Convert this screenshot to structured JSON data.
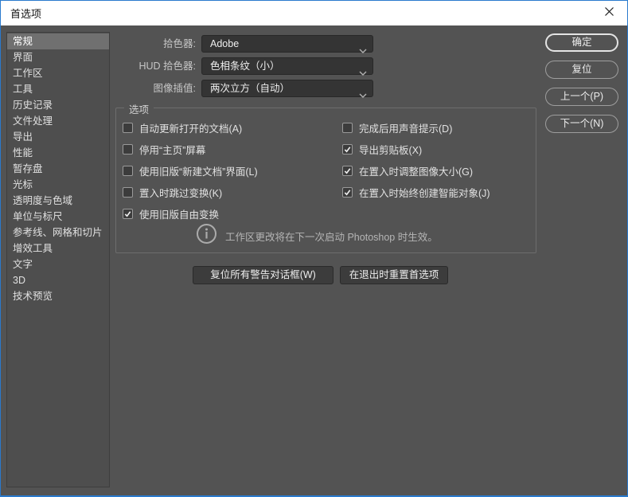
{
  "window": {
    "title": "首选项"
  },
  "sidebar": {
    "items": [
      {
        "label": "常规",
        "selected": true
      },
      {
        "label": "界面",
        "selected": false
      },
      {
        "label": "工作区",
        "selected": false
      },
      {
        "label": "工具",
        "selected": false
      },
      {
        "label": "历史记录",
        "selected": false
      },
      {
        "label": "文件处理",
        "selected": false
      },
      {
        "label": "导出",
        "selected": false
      },
      {
        "label": "性能",
        "selected": false
      },
      {
        "label": "暂存盘",
        "selected": false
      },
      {
        "label": "光标",
        "selected": false
      },
      {
        "label": "透明度与色域",
        "selected": false
      },
      {
        "label": "单位与标尺",
        "selected": false
      },
      {
        "label": "参考线、网格和切片",
        "selected": false
      },
      {
        "label": "增效工具",
        "selected": false
      },
      {
        "label": "文字",
        "selected": false
      },
      {
        "label": "3D",
        "selected": false
      },
      {
        "label": "技术预览",
        "selected": false
      }
    ]
  },
  "pickers": [
    {
      "label": "拾色器:",
      "value": "Adobe"
    },
    {
      "label": "HUD 拾色器:",
      "value": "色相条纹（小）"
    },
    {
      "label": "图像插值:",
      "value": "两次立方（自动）"
    }
  ],
  "options": {
    "legend": "选项",
    "left": [
      {
        "label": "自动更新打开的文档(A)",
        "checked": false
      },
      {
        "label": "停用“主页”屏幕",
        "checked": false
      },
      {
        "label": "使用旧版“新建文档”界面(L)",
        "checked": false
      },
      {
        "label": "置入时跳过变换(K)",
        "checked": false
      },
      {
        "label": "使用旧版自由变换",
        "checked": true
      }
    ],
    "right": [
      {
        "label": "完成后用声音提示(D)",
        "checked": false
      },
      {
        "label": "导出剪贴板(X)",
        "checked": true
      },
      {
        "label": "在置入时调整图像大小(G)",
        "checked": true
      },
      {
        "label": "在置入时始终创建智能对象(J)",
        "checked": true
      }
    ],
    "info_text": "工作区更改将在下一次启动 Photoshop 时生效。"
  },
  "bottom_buttons": {
    "reset_warnings": "复位所有警告对话框(W)",
    "reset_on_quit": "在退出时重置首选项"
  },
  "side_buttons": [
    {
      "label": "确定"
    },
    {
      "label": "复位"
    },
    {
      "label": "上一个(P)"
    },
    {
      "label": "下一个(N)"
    }
  ],
  "colors": {
    "accent_border": "#2a7ace",
    "dialog_bg": "#535353",
    "sidebar_bg": "#4e4e4e",
    "selected_item_bg": "#707070",
    "dropdown_bg": "#343434",
    "group_border": "#6d6d6d",
    "text_light": "#e2e2e2"
  }
}
